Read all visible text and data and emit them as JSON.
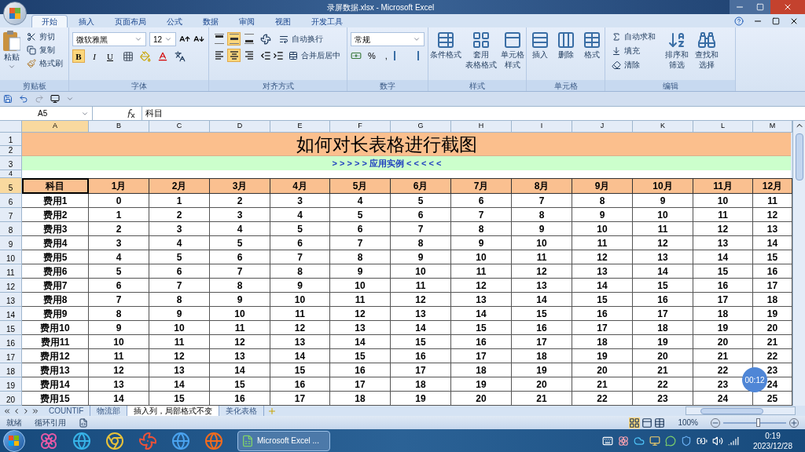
{
  "window": {
    "title": "录屏数据.xlsx - Microsoft Excel"
  },
  "ribbon_tabs": [
    {
      "label": "开始",
      "selected": true
    },
    {
      "label": "插入",
      "selected": false
    },
    {
      "label": "页面布局",
      "selected": false
    },
    {
      "label": "公式",
      "selected": false
    },
    {
      "label": "数据",
      "selected": false
    },
    {
      "label": "审阅",
      "selected": false
    },
    {
      "label": "视图",
      "selected": false
    },
    {
      "label": "开发工具",
      "selected": false
    }
  ],
  "clipboard": {
    "label": "剪贴板",
    "paste": "粘贴",
    "cut": "剪切",
    "copy": "复制",
    "painter": "格式刷"
  },
  "font": {
    "label": "字体",
    "name": "微软雅黑",
    "size": "12",
    "styles": [
      {
        "text": "B",
        "kind": "bold",
        "selected": true
      },
      {
        "text": "I",
        "kind": "italic",
        "selected": false
      },
      {
        "text": "U",
        "kind": "underline",
        "selected": false
      }
    ]
  },
  "alignment": {
    "label": "对齐方式",
    "wrap": "自动换行",
    "merge": "合并后居中",
    "vertical": [
      {
        "kind": "top",
        "selected": false
      },
      {
        "kind": "middle",
        "selected": true
      },
      {
        "kind": "bottom",
        "selected": false
      }
    ],
    "horizontal": [
      {
        "kind": "left",
        "selected": false
      },
      {
        "kind": "center",
        "selected": true
      },
      {
        "kind": "right",
        "selected": false
      }
    ]
  },
  "number": {
    "label": "数字",
    "format": "常规",
    "buttons": [
      "%",
      ","
    ]
  },
  "styles": {
    "label": "样式",
    "buttons": [
      {
        "lines": [
          "条件格式"
        ]
      },
      {
        "lines": [
          "套用",
          "表格格式"
        ]
      },
      {
        "lines": [
          "单元格",
          "样式"
        ]
      }
    ]
  },
  "cells": {
    "label": "单元格",
    "buttons": [
      "插入",
      "删除",
      "格式"
    ]
  },
  "editing": {
    "label": "编辑",
    "small": [
      "自动求和",
      "填充",
      "清除"
    ],
    "large": [
      {
        "lines": [
          "排序和",
          "筛选"
        ]
      },
      {
        "lines": [
          "查找和",
          "选择"
        ]
      }
    ]
  },
  "formula_bar": {
    "name_box": "A5",
    "formula": "科目"
  },
  "columns": [
    {
      "label": "A",
      "selected": true
    },
    {
      "label": "B",
      "selected": false
    },
    {
      "label": "C",
      "selected": false
    },
    {
      "label": "D",
      "selected": false
    },
    {
      "label": "E",
      "selected": false
    },
    {
      "label": "F",
      "selected": false
    },
    {
      "label": "G",
      "selected": false
    },
    {
      "label": "H",
      "selected": false
    },
    {
      "label": "I",
      "selected": false
    },
    {
      "label": "J",
      "selected": false
    },
    {
      "label": "K",
      "selected": false
    },
    {
      "label": "L",
      "selected": false
    },
    {
      "label": "M",
      "selected": false
    }
  ],
  "row_numbers": [
    {
      "label": "1",
      "selected": false
    },
    {
      "label": "2",
      "selected": false
    },
    {
      "label": "3",
      "selected": false
    },
    {
      "label": "4",
      "selected": false
    },
    {
      "label": "5",
      "selected": true
    },
    {
      "label": "6",
      "selected": false
    },
    {
      "label": "7",
      "selected": false
    },
    {
      "label": "8",
      "selected": false
    },
    {
      "label": "9",
      "selected": false
    },
    {
      "label": "10",
      "selected": false
    },
    {
      "label": "11",
      "selected": false
    },
    {
      "label": "12",
      "selected": false
    },
    {
      "label": "13",
      "selected": false
    },
    {
      "label": "14",
      "selected": false
    },
    {
      "label": "15",
      "selected": false
    },
    {
      "label": "16",
      "selected": false
    },
    {
      "label": "17",
      "selected": false
    },
    {
      "label": "18",
      "selected": false
    },
    {
      "label": "19",
      "selected": false
    },
    {
      "label": "20",
      "selected": false
    }
  ],
  "sheet": {
    "title": "如何对长表格进行截图",
    "subtitle": "> > > > > 应用实例 < < < < <",
    "header": [
      "科目",
      "1月",
      "2月",
      "3月",
      "4月",
      "5月",
      "6月",
      "7月",
      "8月",
      "9月",
      "10月",
      "11月",
      "12月"
    ],
    "rows": [
      [
        "费用1",
        "0",
        "1",
        "2",
        "3",
        "4",
        "5",
        "6",
        "7",
        "8",
        "9",
        "10",
        "11"
      ],
      [
        "费用2",
        "1",
        "2",
        "3",
        "4",
        "5",
        "6",
        "7",
        "8",
        "9",
        "10",
        "11",
        "12"
      ],
      [
        "费用3",
        "2",
        "3",
        "4",
        "5",
        "6",
        "7",
        "8",
        "9",
        "10",
        "11",
        "12",
        "13"
      ],
      [
        "费用4",
        "3",
        "4",
        "5",
        "6",
        "7",
        "8",
        "9",
        "10",
        "11",
        "12",
        "13",
        "14"
      ],
      [
        "费用5",
        "4",
        "5",
        "6",
        "7",
        "8",
        "9",
        "10",
        "11",
        "12",
        "13",
        "14",
        "15"
      ],
      [
        "费用6",
        "5",
        "6",
        "7",
        "8",
        "9",
        "10",
        "11",
        "12",
        "13",
        "14",
        "15",
        "16"
      ],
      [
        "费用7",
        "6",
        "7",
        "8",
        "9",
        "10",
        "11",
        "12",
        "13",
        "14",
        "15",
        "16",
        "17"
      ],
      [
        "费用8",
        "7",
        "8",
        "9",
        "10",
        "11",
        "12",
        "13",
        "14",
        "15",
        "16",
        "17",
        "18"
      ],
      [
        "费用9",
        "8",
        "9",
        "10",
        "11",
        "12",
        "13",
        "14",
        "15",
        "16",
        "17",
        "18",
        "19"
      ],
      [
        "费用10",
        "9",
        "10",
        "11",
        "12",
        "13",
        "14",
        "15",
        "16",
        "17",
        "18",
        "19",
        "20"
      ],
      [
        "费用11",
        "10",
        "11",
        "12",
        "13",
        "14",
        "15",
        "16",
        "17",
        "18",
        "19",
        "20",
        "21"
      ],
      [
        "费用12",
        "11",
        "12",
        "13",
        "14",
        "15",
        "16",
        "17",
        "18",
        "19",
        "20",
        "21",
        "22"
      ],
      [
        "费用13",
        "12",
        "13",
        "14",
        "15",
        "16",
        "17",
        "18",
        "19",
        "20",
        "21",
        "22",
        "23"
      ],
      [
        "费用14",
        "13",
        "14",
        "15",
        "16",
        "17",
        "18",
        "19",
        "20",
        "21",
        "22",
        "23",
        "24"
      ],
      [
        "费用15",
        "14",
        "15",
        "16",
        "17",
        "18",
        "19",
        "20",
        "21",
        "22",
        "23",
        "24",
        "25"
      ]
    ]
  },
  "sheet_tabs": [
    {
      "label": "COUNTIF",
      "selected": false
    },
    {
      "label": "物流部",
      "selected": false
    },
    {
      "label": "插入列，局部格式不变",
      "selected": true
    },
    {
      "label": "美化表格",
      "selected": false
    }
  ],
  "status_bar": {
    "ready": "就绪",
    "circular": "循环引用",
    "zoom": "100%",
    "zoom_slider": {
      "level": 0.55
    }
  },
  "recording_timer": "00:12",
  "taskbar": {
    "app": "Microsoft Excel ...",
    "time": "0:19",
    "date": "2023/12/28"
  }
}
